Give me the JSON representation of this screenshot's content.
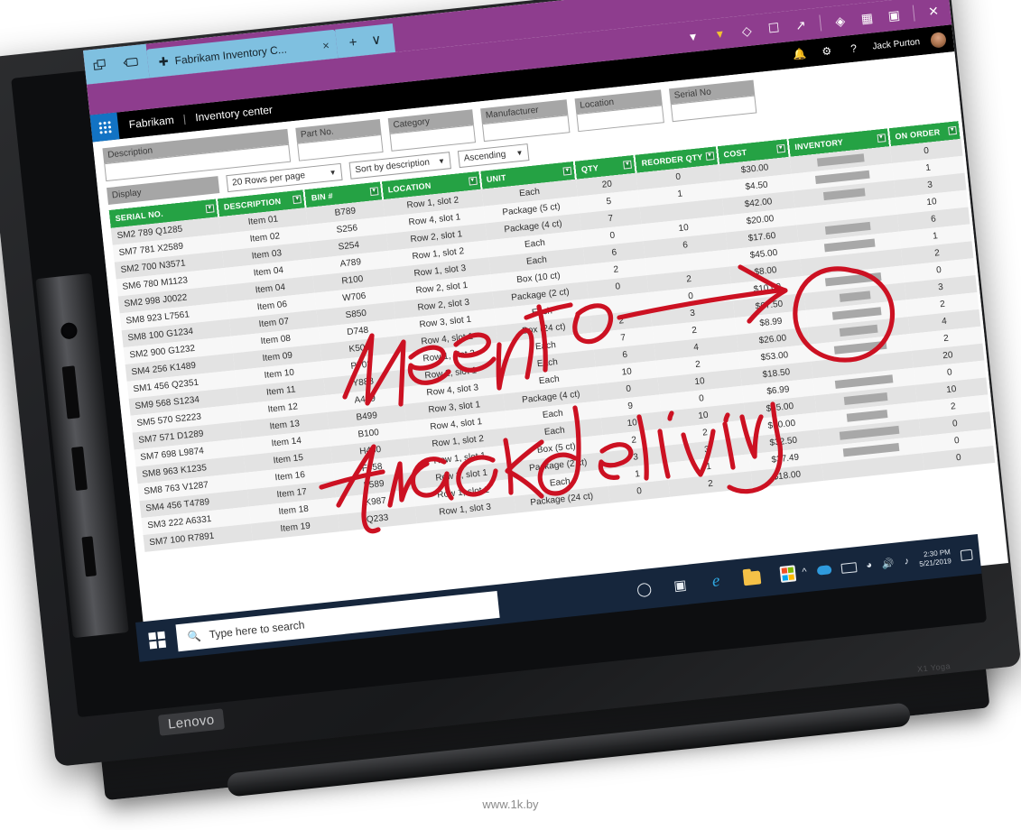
{
  "browser": {
    "tab_title": "Fabrikam Inventory C...",
    "tab_icon": "pen-icon",
    "close_label": "×",
    "new_tab_label": "+",
    "tab_menu_label": "∨",
    "window_minimize": "–",
    "window_maximize": "□",
    "window_close": "✕"
  },
  "app": {
    "brand": "Fabrikam",
    "separator": "|",
    "section": "Inventory center",
    "user_name": "Jack Purton",
    "toolbar_icons": [
      "filter-red-icon",
      "filter-yellow-icon",
      "tag-icon",
      "comment-icon",
      "share-icon",
      "pin-icon",
      "save-icon",
      "archive-icon",
      "close-icon"
    ],
    "header_icons": [
      "bell-icon",
      "gear-icon",
      "help-icon"
    ]
  },
  "filters": {
    "description": {
      "label": "Description",
      "value": "",
      "placeholder": ""
    },
    "part_no": {
      "label": "Part No.",
      "value": "",
      "placeholder": ""
    },
    "category": {
      "label": "Category",
      "value": "",
      "placeholder": ""
    },
    "manufacturer": {
      "label": "Manufacturer",
      "value": "",
      "placeholder": ""
    },
    "location": {
      "label": "Location",
      "value": "",
      "placeholder": ""
    },
    "serial_no": {
      "label": "Serial No",
      "value": "",
      "placeholder": ""
    },
    "display_label": "Display",
    "rows_per_page": "20 Rows per page",
    "sort_by": "Sort by description",
    "sort_order": "Ascending"
  },
  "table": {
    "columns": [
      "SERIAL NO.",
      "DESCRIPTION",
      "BIN #",
      "LOCATION",
      "UNIT",
      "QTY",
      "REORDER QTY",
      "COST",
      "INVENTORY",
      "ON ORDER"
    ],
    "rows": [
      {
        "serial": "SM2 789 Q1285",
        "desc": "Item 01",
        "bin": "B789",
        "loc": "Row 1, slot 2",
        "unit": "Each",
        "qty": "20",
        "reorder": "0",
        "cost": "$30.00",
        "inv": 52,
        "order": "0"
      },
      {
        "serial": "SM7 781 X2589",
        "desc": "Item 02",
        "bin": "S256",
        "loc": "Row 4, slot 1",
        "unit": "Package (5 ct)",
        "qty": "5",
        "reorder": "1",
        "cost": "$4.50",
        "inv": 60,
        "order": "1"
      },
      {
        "serial": "SM2 700 N3571",
        "desc": "Item 03",
        "bin": "S254",
        "loc": "Row 2, slot 1",
        "unit": "Package (4 ct)",
        "qty": "7",
        "reorder": "",
        "cost": "$42.00",
        "inv": 46,
        "order": "3"
      },
      {
        "serial": "SM6 780 M1123",
        "desc": "Item 04",
        "bin": "A789",
        "loc": "Row 1, slot 2",
        "unit": "Each",
        "qty": "0",
        "reorder": "10",
        "cost": "$20.00",
        "inv": 0,
        "order": "10"
      },
      {
        "serial": "SM2 998 J0022",
        "desc": "Item 04",
        "bin": "R100",
        "loc": "Row 1, slot 3",
        "unit": "Each",
        "qty": "6",
        "reorder": "6",
        "cost": "$17.60",
        "inv": 50,
        "order": "6"
      },
      {
        "serial": "SM8 923 L7561",
        "desc": "Item 06",
        "bin": "W706",
        "loc": "Row 2, slot 1",
        "unit": "Box (10 ct)",
        "qty": "2",
        "reorder": "",
        "cost": "$45.00",
        "inv": 56,
        "order": "1"
      },
      {
        "serial": "SM8 100 G1234",
        "desc": "Item 07",
        "bin": "S850",
        "loc": "Row 2, slot 3",
        "unit": "Package (2 ct)",
        "qty": "0",
        "reorder": "2",
        "cost": "$8.00",
        "inv": 0,
        "order": "2"
      },
      {
        "serial": "SM2 900 G1232",
        "desc": "Item 08",
        "bin": "D748",
        "loc": "Row 3, slot 1",
        "unit": "Each",
        "qty": "",
        "reorder": "0",
        "cost": "$10.00",
        "inv": 62,
        "order": "0"
      },
      {
        "serial": "SM4 256 K1489",
        "desc": "Item 09",
        "bin": "K500",
        "loc": "Row 4, slot 1",
        "unit": "Box (24 ct)",
        "qty": "2",
        "reorder": "3",
        "cost": "$67.50",
        "inv": 34,
        "order": "3"
      },
      {
        "serial": "SM1 456 Q2351",
        "desc": "Item 10",
        "bin": "P703",
        "loc": "Row 1, slot 3",
        "unit": "Each",
        "qty": "7",
        "reorder": "2",
        "cost": "$8.99",
        "inv": 54,
        "order": "2"
      },
      {
        "serial": "SM9 568 S1234",
        "desc": "Item 11",
        "bin": "Y888",
        "loc": "Row 2, slot 1",
        "unit": "Each",
        "qty": "6",
        "reorder": "4",
        "cost": "$26.00",
        "inv": 42,
        "order": "4"
      },
      {
        "serial": "SM5 570 S2223",
        "desc": "Item 12",
        "bin": "A499",
        "loc": "Row 4, slot 3",
        "unit": "Each",
        "qty": "10",
        "reorder": "2",
        "cost": "$53.00",
        "inv": 58,
        "order": "2"
      },
      {
        "serial": "SM7 571 D1289",
        "desc": "Item 13",
        "bin": "B499",
        "loc": "Row 3, slot 1",
        "unit": "Package (4 ct)",
        "qty": "0",
        "reorder": "10",
        "cost": "$18.50",
        "inv": 0,
        "order": "20"
      },
      {
        "serial": "SM7 698 L9874",
        "desc": "Item 14",
        "bin": "B100",
        "loc": "Row 4, slot 1",
        "unit": "Each",
        "qty": "9",
        "reorder": "0",
        "cost": "$6.99",
        "inv": 64,
        "order": "0"
      },
      {
        "serial": "SM8 963 K1235",
        "desc": "Item 15",
        "bin": "H450",
        "loc": "Row 1, slot 2",
        "unit": "Each",
        "qty": "10",
        "reorder": "10",
        "cost": "$45.00",
        "inv": 48,
        "order": "10"
      },
      {
        "serial": "SM8 763 V1287",
        "desc": "Item 16",
        "bin": "F458",
        "loc": "Row 1, slot 1",
        "unit": "Box (5 ct)",
        "qty": "2",
        "reorder": "2",
        "cost": "$60.00",
        "inv": 45,
        "order": "2"
      },
      {
        "serial": "SM4 456 T4789",
        "desc": "Item 17",
        "bin": "F589",
        "loc": "Row 2, slot 1",
        "unit": "Package (2 ct)",
        "qty": "3",
        "reorder": "3",
        "cost": "$32.50",
        "inv": 66,
        "order": "0"
      },
      {
        "serial": "SM3 222 A6331",
        "desc": "Item 18",
        "bin": "K987",
        "loc": "Row 1, slot 2",
        "unit": "Each",
        "qty": "1",
        "reorder": "1",
        "cost": "$37.49",
        "inv": 62,
        "order": "0"
      },
      {
        "serial": "SM7 100 R7891",
        "desc": "Item 19",
        "bin": "Q233",
        "loc": "Row 1, slot 3",
        "unit": "Package (24 ct)",
        "qty": "0",
        "reorder": "2",
        "cost": "$18.00",
        "inv": 0,
        "order": "0"
      }
    ]
  },
  "taskbar": {
    "search_placeholder": "Type here to search",
    "icons": [
      "cortana-icon",
      "task-view-icon",
      "edge-icon",
      "file-explorer-icon",
      "microsoft-store-icon"
    ],
    "tray_icons": [
      "show-hidden-icons-chevron",
      "onedrive-icon",
      "display-icon",
      "wifi-icon",
      "volume-icon",
      "pen-settings-icon"
    ],
    "clock_time": "2:30 PM",
    "clock_date": "5/21/2019",
    "action_center": "action-center-icon"
  },
  "annotation": {
    "line1": "Need to",
    "line2": "track delivery",
    "color": "#cc1122"
  },
  "device": {
    "vendor_badge": "Lenovo",
    "model_badge": "X1 Yoga"
  },
  "watermark": "www.1k.by"
}
